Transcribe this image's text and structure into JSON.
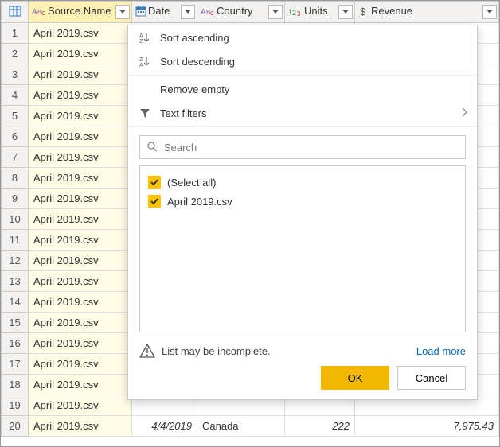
{
  "columns": [
    {
      "name": "Source.Name",
      "type": "text"
    },
    {
      "name": "Date",
      "type": "date"
    },
    {
      "name": "Country",
      "type": "text"
    },
    {
      "name": "Units",
      "type": "int"
    },
    {
      "name": "Revenue",
      "type": "currency"
    }
  ],
  "row_count": 20,
  "source_name_value": "April 2019.csv",
  "visible_row": {
    "index": 20,
    "source_name": "April 2019.csv",
    "date": "4/4/2019",
    "country": "Canada",
    "units": "222",
    "revenue": "7,975.43"
  },
  "menu": {
    "sort_asc": "Sort ascending",
    "sort_desc": "Sort descending",
    "remove_empty": "Remove empty",
    "text_filters": "Text filters",
    "search_placeholder": "Search",
    "items": [
      {
        "label": "(Select all)",
        "checked": true
      },
      {
        "label": "April 2019.csv",
        "checked": true
      }
    ],
    "warn": "List may be incomplete.",
    "load_more": "Load more",
    "ok": "OK",
    "cancel": "Cancel"
  }
}
